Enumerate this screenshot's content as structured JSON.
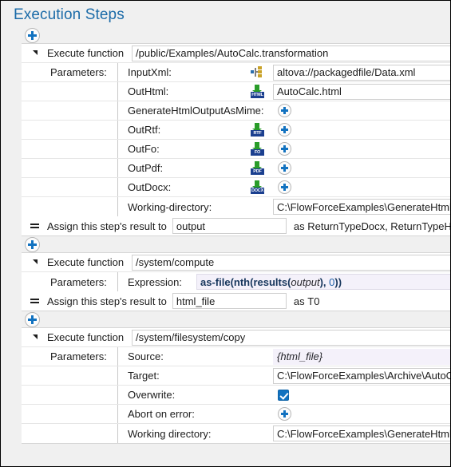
{
  "page": {
    "title": "Execution Steps",
    "title_color": "#1b6ba8",
    "accent_color": "#1272c0",
    "background": "#f0f0f0"
  },
  "labels": {
    "execute_function": "Execute function",
    "parameters": "Parameters:",
    "assign_result": "Assign this step's result to",
    "as": "as"
  },
  "steps": [
    {
      "function": "/public/Examples/AutoCalc.transformation",
      "parameters": [
        {
          "name": "InputXml:",
          "icon": "xml-schema-icon",
          "value": "altova://packagedfile/Data.xml",
          "kind": "text"
        },
        {
          "name": "OutHtml:",
          "icon": "html-file-icon",
          "value": "AutoCalc.html",
          "kind": "text",
          "tag": "HTML"
        },
        {
          "name": "GenerateHtmlOutputAsMime:",
          "icon": "none",
          "value": "",
          "kind": "add"
        },
        {
          "name": "OutRtf:",
          "icon": "rtf-file-icon",
          "value": "",
          "kind": "add",
          "tag": "RTF"
        },
        {
          "name": "OutFo:",
          "icon": "fo-file-icon",
          "value": "",
          "kind": "add",
          "tag": "FO"
        },
        {
          "name": "OutPdf:",
          "icon": "pdf-file-icon",
          "value": "",
          "kind": "add",
          "tag": "PDF"
        },
        {
          "name": "OutDocx:",
          "icon": "docx-file-icon",
          "value": "",
          "kind": "add",
          "tag": "DOCX"
        },
        {
          "name": "Working-directory:",
          "icon": "none",
          "value": "C:\\FlowForceExamples\\GenerateHtml",
          "kind": "text"
        }
      ],
      "result_variable": "output",
      "result_type": "ReturnTypeDocx, ReturnTypeHtml,"
    },
    {
      "function": "/system/compute",
      "expression_label": "Expression:",
      "expression": "as-file(nth(results(output), 0))",
      "result_variable": "html_file",
      "result_type": "T0"
    },
    {
      "function": "/system/filesystem/copy",
      "parameters": [
        {
          "name": "Source:",
          "icon": "none",
          "value": "{html_file}",
          "kind": "var"
        },
        {
          "name": "Target:",
          "icon": "none",
          "value": "C:\\FlowForceExamples\\Archive\\AutoCalc.html",
          "kind": "text"
        },
        {
          "name": "Overwrite:",
          "icon": "none",
          "value": "",
          "kind": "checkbox",
          "checked": true
        },
        {
          "name": "Abort on error:",
          "icon": "none",
          "value": "",
          "kind": "add"
        },
        {
          "name": "Working directory:",
          "icon": "none",
          "value": "C:\\FlowForceExamples\\GenerateHtml",
          "kind": "text"
        }
      ]
    }
  ],
  "add_buttons": {
    "label": "add-step",
    "count": 3
  }
}
